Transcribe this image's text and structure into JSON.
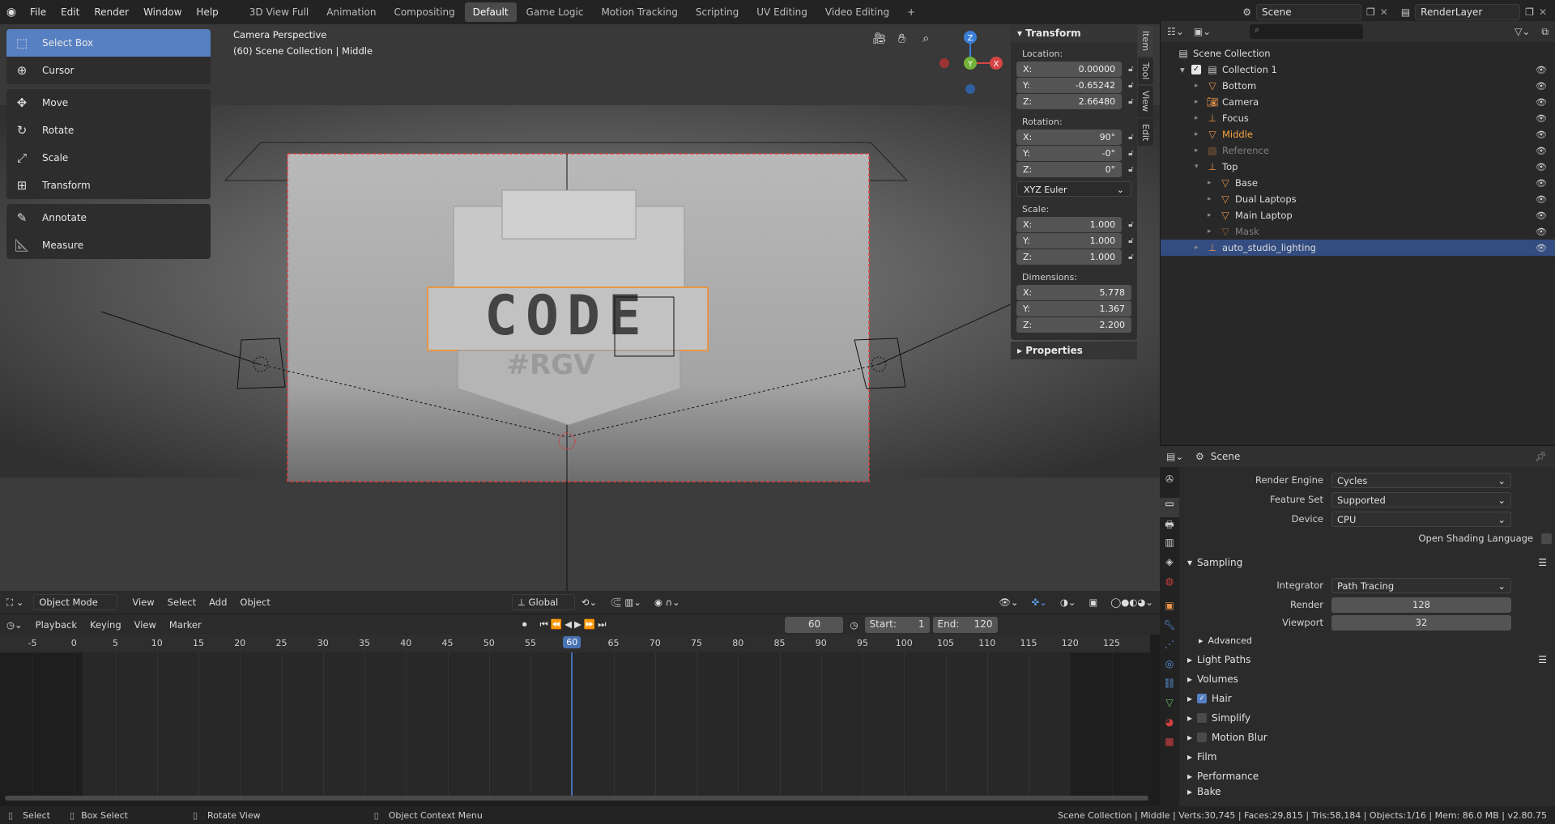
{
  "topbar": {
    "menu": [
      "File",
      "Edit",
      "Render",
      "Window",
      "Help"
    ],
    "workspaces": [
      "3D View Full",
      "Animation",
      "Compositing",
      "Default",
      "Game Logic",
      "Motion Tracking",
      "Scripting",
      "UV Editing",
      "Video Editing"
    ],
    "active_workspace": "Default",
    "scene": "Scene",
    "view_layer": "RenderLayer"
  },
  "viewport": {
    "overlay_title": "Camera Perspective",
    "overlay_subtitle": "(60) Scene Collection | Middle",
    "gizmo": {
      "z": "Z",
      "y": "Y",
      "x": "X"
    }
  },
  "tools": {
    "group1": [
      {
        "label": "Select Box",
        "icon": "select-box-icon"
      },
      {
        "label": "Cursor",
        "icon": "cursor-icon"
      }
    ],
    "group2": [
      {
        "label": "Move"
      },
      {
        "label": "Rotate"
      },
      {
        "label": "Scale"
      },
      {
        "label": "Transform"
      }
    ],
    "group3": [
      {
        "label": "Annotate"
      },
      {
        "label": "Measure"
      }
    ]
  },
  "transform": {
    "title": "Transform",
    "location_label": "Location:",
    "location": {
      "x": "0.00000",
      "y": "-0.65242",
      "z": "2.66480"
    },
    "rotation_label": "Rotation:",
    "rotation": {
      "x": "90°",
      "y": "-0°",
      "z": "0°"
    },
    "rotation_mode": "XYZ Euler",
    "scale_label": "Scale:",
    "scale": {
      "x": "1.000",
      "y": "1.000",
      "z": "1.000"
    },
    "dimensions_label": "Dimensions:",
    "dimensions": {
      "x": "5.778",
      "y": "1.367",
      "z": "2.200"
    },
    "properties_label": "Properties",
    "axis": {
      "x": "X:",
      "y": "Y:",
      "z": "Z:"
    }
  },
  "sidetabs": [
    "Item",
    "Tool",
    "View",
    "Edit"
  ],
  "outliner": {
    "root": "Scene Collection",
    "collection": "Collection 1",
    "items": [
      {
        "name": "Bottom",
        "indent": 2
      },
      {
        "name": "Camera",
        "indent": 2
      },
      {
        "name": "Focus",
        "indent": 2
      },
      {
        "name": "Middle",
        "indent": 2
      },
      {
        "name": "Reference",
        "indent": 2
      },
      {
        "name": "Top",
        "indent": 2
      },
      {
        "name": "Base",
        "indent": 3
      },
      {
        "name": "Dual Laptops",
        "indent": 3
      },
      {
        "name": "Main Laptop",
        "indent": 3
      },
      {
        "name": "Mask",
        "indent": 3
      },
      {
        "name": "auto_studio_lighting",
        "indent": 2
      }
    ]
  },
  "properties": {
    "context": "Scene",
    "render_engine_label": "Render Engine",
    "render_engine": "Cycles",
    "feature_set_label": "Feature Set",
    "feature_set": "Supported",
    "device_label": "Device",
    "device": "CPU",
    "osl_label": "Open Shading Language",
    "sampling": "Sampling",
    "integrator_label": "Integrator",
    "integrator": "Path Tracing",
    "render_label": "Render",
    "render_samples": "128",
    "viewport_label": "Viewport",
    "viewport_samples": "32",
    "advanced": "Advanced",
    "light_paths": "Light Paths",
    "volumes": "Volumes",
    "hair": "Hair",
    "simplify": "Simplify",
    "motion_blur": "Motion Blur",
    "film": "Film",
    "performance": "Performance",
    "bake": "Bake"
  },
  "view_header": {
    "mode": "Object Mode",
    "menus": [
      "View",
      "Select",
      "Add",
      "Object"
    ],
    "orientation": "Global"
  },
  "timeline_header": {
    "menus": [
      "Playback",
      "Keying",
      "View",
      "Marker"
    ],
    "current_frame": "60",
    "start_label": "Start:",
    "start": "1",
    "end_label": "End:",
    "end": "120"
  },
  "timeline": {
    "ticks": [
      "-5",
      "0",
      "5",
      "10",
      "15",
      "20",
      "25",
      "30",
      "35",
      "40",
      "45",
      "50",
      "55",
      "60",
      "65",
      "70",
      "75",
      "80",
      "85",
      "90",
      "95",
      "100",
      "105",
      "110",
      "115",
      "120",
      "125"
    ],
    "current": 60
  },
  "status": {
    "select": "Select",
    "box_select": "Box Select",
    "rotate_view": "Rotate View",
    "context_menu": "Object Context Menu",
    "info": "Scene Collection | Middle | Verts:30,745 | Faces:29,815 | Tris:58,184 | Objects:1/16 | Mem: 86.0 MB | v2.80.75"
  }
}
